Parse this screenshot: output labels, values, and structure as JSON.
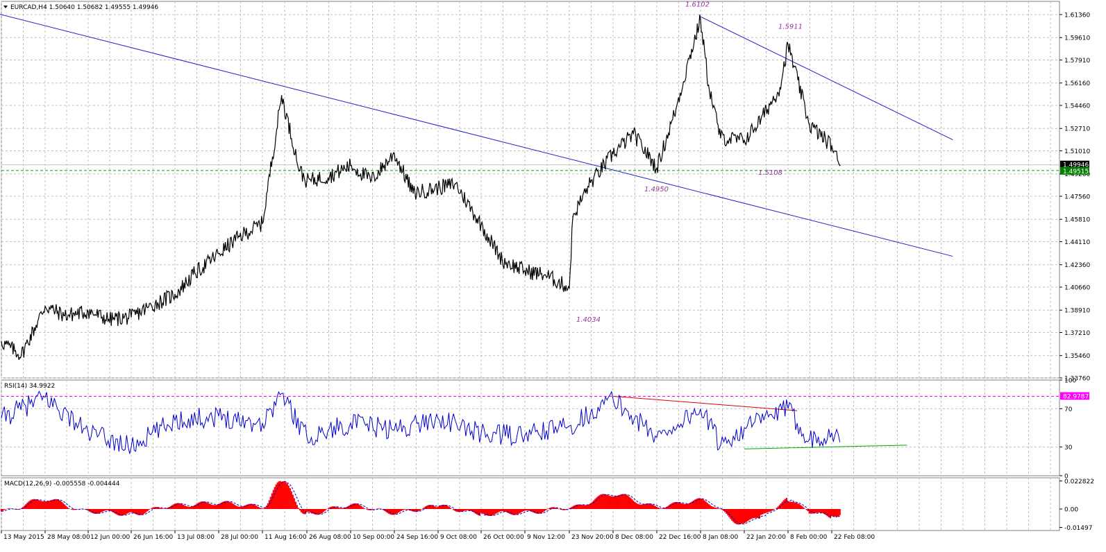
{
  "chart_data": [
    {
      "type": "line",
      "panel": "main",
      "title": "EURCAD,H4  1.50640 1.50682 1.49555 1.49946",
      "symbol_info": {
        "symbol": "EURCAD",
        "timeframe": "H4",
        "open": "1.50640",
        "high": "1.50682",
        "low": "1.49555",
        "close": "1.49946"
      },
      "ylim": [
        1.3376,
        1.6236
      ],
      "y_ticks": [
        "1.61360",
        "1.59610",
        "1.57910",
        "1.56160",
        "1.54460",
        "1.52710",
        "1.51010",
        "1.49260",
        "1.47560",
        "1.45810",
        "1.44110",
        "1.42360",
        "1.40660",
        "1.38910",
        "1.37210",
        "1.35460",
        "1.33760"
      ],
      "x_ticks": [
        "13 May 2015",
        "28 May 08:00",
        "12 Jun 00:00",
        "26 Jun 16:00",
        "13 Jul 08:00",
        "28 Jul 00:00",
        "11 Aug 16:00",
        "26 Aug 08:00",
        "10 Sep 00:00",
        "24 Sep 16:00",
        "9 Oct 08:00",
        "26 Oct 00:00",
        "9 Nov 12:00",
        "23 Nov 20:00",
        "8 Dec 08:00",
        "22 Dec 16:00",
        "8 Jan 08:00",
        "22 Jan 20:00",
        "8 Feb 00:00",
        "22 Feb 08:00"
      ],
      "series": [
        {
          "x": [
            "13 May 2015",
            "20 May",
            "28 May 08:00",
            "4 Jun",
            "12 Jun 00:00",
            "19 Jun",
            "26 Jun 16:00",
            "3 Jul",
            "13 Jul 08:00",
            "20 Jul",
            "28 Jul 00:00",
            "4 Aug",
            "11 Aug 16:00",
            "18 Aug",
            "24 Aug",
            "26 Aug 08:00",
            "3 Sep",
            "10 Sep 00:00",
            "17 Sep",
            "24 Sep 16:00",
            "1 Oct",
            "9 Oct 08:00",
            "16 Oct",
            "26 Oct 00:00",
            "2 Nov",
            "9 Nov 12:00",
            "16 Nov",
            "23 Nov 20:00",
            "25 Nov",
            "30 Nov",
            "8 Dec 08:00",
            "15 Dec",
            "22 Dec 16:00",
            "30 Dec",
            "4 Jan",
            "8 Jan 08:00",
            "11 Jan",
            "15 Jan",
            "22 Jan 20:00",
            "29 Jan",
            "5 Feb",
            "8 Feb 00:00",
            "15 Feb",
            "22 Feb 08:00",
            "25 Feb"
          ],
          "values": [
            1.365,
            1.355,
            1.392,
            1.385,
            1.388,
            1.382,
            1.384,
            1.391,
            1.401,
            1.417,
            1.432,
            1.445,
            1.455,
            1.552,
            1.495,
            1.487,
            1.491,
            1.499,
            1.488,
            1.508,
            1.478,
            1.482,
            1.485,
            1.454,
            1.427,
            1.419,
            1.416,
            1.406,
            1.46,
            1.483,
            1.508,
            1.523,
            1.497,
            1.542,
            1.58,
            1.61,
            1.56,
            1.52,
            1.518,
            1.534,
            1.558,
            1.591,
            1.53,
            1.514,
            1.499
          ]
        }
      ],
      "horizontal_lines": [
        {
          "value": 1.49946,
          "label": "1.49946",
          "style": "solid",
          "color": "#c0c0c0"
        },
        {
          "value": 1.49515,
          "label": "1.49515",
          "style": "dashed",
          "color": "#00a000"
        }
      ],
      "trendlines": [
        {
          "from": {
            "x": "24 Apr 2015",
            "y": 1.624
          },
          "to": {
            "x": "2 Apr 2016",
            "y": 1.43
          },
          "color": "#2020cc"
        },
        {
          "from": {
            "x": "8 Jan 08:00",
            "y": 1.612
          },
          "to": {
            "x": "2 Apr 2016",
            "y": 1.5185
          },
          "color": "#2020cc"
        }
      ],
      "annotations": [
        "1.6102",
        "1.5911",
        "1.5108",
        "1.4950",
        "1.4034"
      ],
      "colors": {
        "price": "#000000",
        "trendline": "#2020cc",
        "annotation": "#993399",
        "grid": "#c0c0c0"
      }
    },
    {
      "type": "line",
      "panel": "rsi",
      "title": "RSI(14) 34.9922",
      "ylim": [
        0,
        100
      ],
      "y_ticks": [
        "100",
        "70",
        "30",
        "0"
      ],
      "levels": [
        {
          "value": 82.9787,
          "label": "82.9787",
          "color": "#ff00ff"
        }
      ],
      "series": [
        {
          "x": [
            "13 May 2015",
            "28 May 08:00",
            "12 Jun 00:00",
            "26 Jun 16:00",
            "13 Jul 08:00",
            "28 Jul 00:00",
            "11 Aug 16:00",
            "18 Aug",
            "26 Aug 08:00",
            "10 Sep 00:00",
            "24 Sep 16:00",
            "9 Oct 08:00",
            "26 Oct 00:00",
            "9 Nov 12:00",
            "23 Nov 20:00",
            "8 Dec 08:00",
            "22 Dec 16:00",
            "8 Jan 08:00",
            "15 Jan",
            "22 Jan 20:00",
            "8 Feb 00:00",
            "15 Feb",
            "22 Feb 08:00",
            "25 Feb"
          ],
          "values": [
            60,
            82,
            45,
            30,
            58,
            62,
            55,
            86,
            40,
            55,
            48,
            60,
            44,
            42,
            52,
            80,
            40,
            70,
            32,
            50,
            70,
            38,
            45,
            35
          ]
        }
      ],
      "trendlines": [
        {
          "from": {
            "x": "8 Dec 08:00",
            "y": 83
          },
          "to": {
            "x": "11 Feb",
            "y": 68
          },
          "color": "#dd0000"
        },
        {
          "from": {
            "x": "22 Jan 20:00",
            "y": 28
          },
          "to": {
            "x": "18 Mar 2016",
            "y": 32
          },
          "color": "#00aa00"
        }
      ],
      "colors": {
        "line": "#0000cc"
      }
    },
    {
      "type": "bar",
      "panel": "macd",
      "title": "MACD(12,26,9) -0.005558 -0.004444",
      "ylim": [
        -0.0175,
        0.0254
      ],
      "y_ticks": [
        "0.022822",
        "0.00",
        "-0.01497"
      ],
      "series": [
        {
          "x": [
            "13 May 2015",
            "28 May 08:00",
            "12 Jun 00:00",
            "26 Jun 16:00",
            "13 Jul 08:00",
            "28 Jul 00:00",
            "11 Aug 16:00",
            "18 Aug",
            "26 Aug 08:00",
            "10 Sep 00:00",
            "24 Sep 16:00",
            "9 Oct 08:00",
            "26 Oct 00:00",
            "9 Nov 12:00",
            "23 Nov 20:00",
            "8 Dec 08:00",
            "22 Dec 16:00",
            "8 Jan 08:00",
            "22 Jan 20:00",
            "29 Jan",
            "8 Feb 00:00",
            "15 Feb",
            "22 Feb 08:00",
            "25 Feb"
          ],
          "values": [
            -0.002,
            0.008,
            -0.002,
            -0.004,
            0.003,
            0.005,
            0.002,
            0.022,
            -0.004,
            0.003,
            -0.003,
            0.002,
            -0.004,
            -0.003,
            0.001,
            0.012,
            0.002,
            0.007,
            -0.012,
            -0.006,
            0.008,
            -0.002,
            -0.007,
            -0.005
          ]
        }
      ],
      "colors": {
        "hist": "#ff0000",
        "signal": "#0000cc"
      }
    }
  ]
}
